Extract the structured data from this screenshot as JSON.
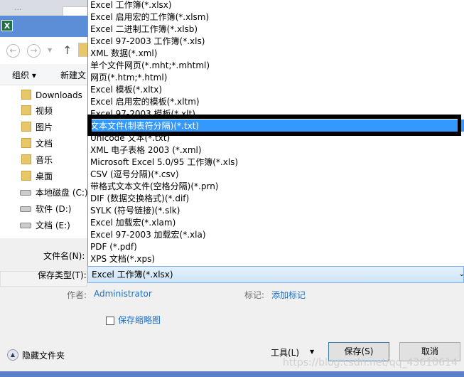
{
  "window": {
    "tab_text": "...",
    "app_icon": "excel-icon"
  },
  "toolbar": {
    "organize": "组织 ▾",
    "new_folder": "新建文"
  },
  "sidebar": {
    "items": [
      {
        "label": "Downloads",
        "icon": "folder-download-icon"
      },
      {
        "label": "视频",
        "icon": "folder-video-icon"
      },
      {
        "label": "图片",
        "icon": "folder-pictures-icon"
      },
      {
        "label": "文档",
        "icon": "folder-documents-icon"
      },
      {
        "label": "音乐",
        "icon": "folder-music-icon"
      },
      {
        "label": "桌面",
        "icon": "folder-desktop-icon"
      },
      {
        "label": "本地磁盘 (C:)",
        "icon": "drive-icon",
        "selected": true
      },
      {
        "label": "软件 (D:)",
        "icon": "drive-icon"
      },
      {
        "label": "文档 (E:)",
        "icon": "drive-icon"
      }
    ]
  },
  "dropdown": {
    "selected_index": 10,
    "items": [
      "Excel 工作簿(*.xlsx)",
      "Excel 启用宏的工作簿(*.xlsm)",
      "Excel 二进制工作簿(*.xlsb)",
      "Excel 97-2003 工作簿(*.xls)",
      "XML 数据(*.xml)",
      "单个文件网页(*.mht;*.mhtml)",
      "网页(*.htm;*.html)",
      "Excel 模板(*.xltx)",
      "Excel 启用宏的模板(*.xltm)",
      "Excel 97-2003 模板(*.xlt)",
      "文本文件(制表符分隔)(*.txt)",
      "Unicode 文本(*.txt)",
      "XML 电子表格 2003 (*.xml)",
      "Microsoft Excel 5.0/95 工作簿(*.xls)",
      "CSV (逗号分隔)(*.csv)",
      "带格式文本文件(空格分隔)(*.prn)",
      "DIF (数据交换格式)(*.dif)",
      "SYLK (符号链接)(*.slk)",
      "Excel 加载宏(*.xlam)",
      "Excel 97-2003 加载宏(*.xla)",
      "PDF (*.pdf)",
      "XPS 文档(*.xps)"
    ]
  },
  "form": {
    "filename_label": "文件名(N):",
    "savetype_label": "保存类型(T):",
    "savetype_value": "Excel 工作簿(*.xlsx)",
    "author_label": "作者:",
    "author_value": "Administrator",
    "tags_label": "标记:",
    "tags_value": "添加标记",
    "thumbnail_label": "保存缩略图",
    "thumbnail_checked": false
  },
  "footer": {
    "hide_folders": "隐藏文件夹",
    "tools": "工具(L)",
    "save": "保存(S)",
    "cancel": "取消"
  },
  "watermark": "https://blog.csdn.net/qq_43610614",
  "colors": {
    "titlebar": "#5b8ed6",
    "highlight": "#3399ff",
    "link": "#1a6fc9"
  }
}
